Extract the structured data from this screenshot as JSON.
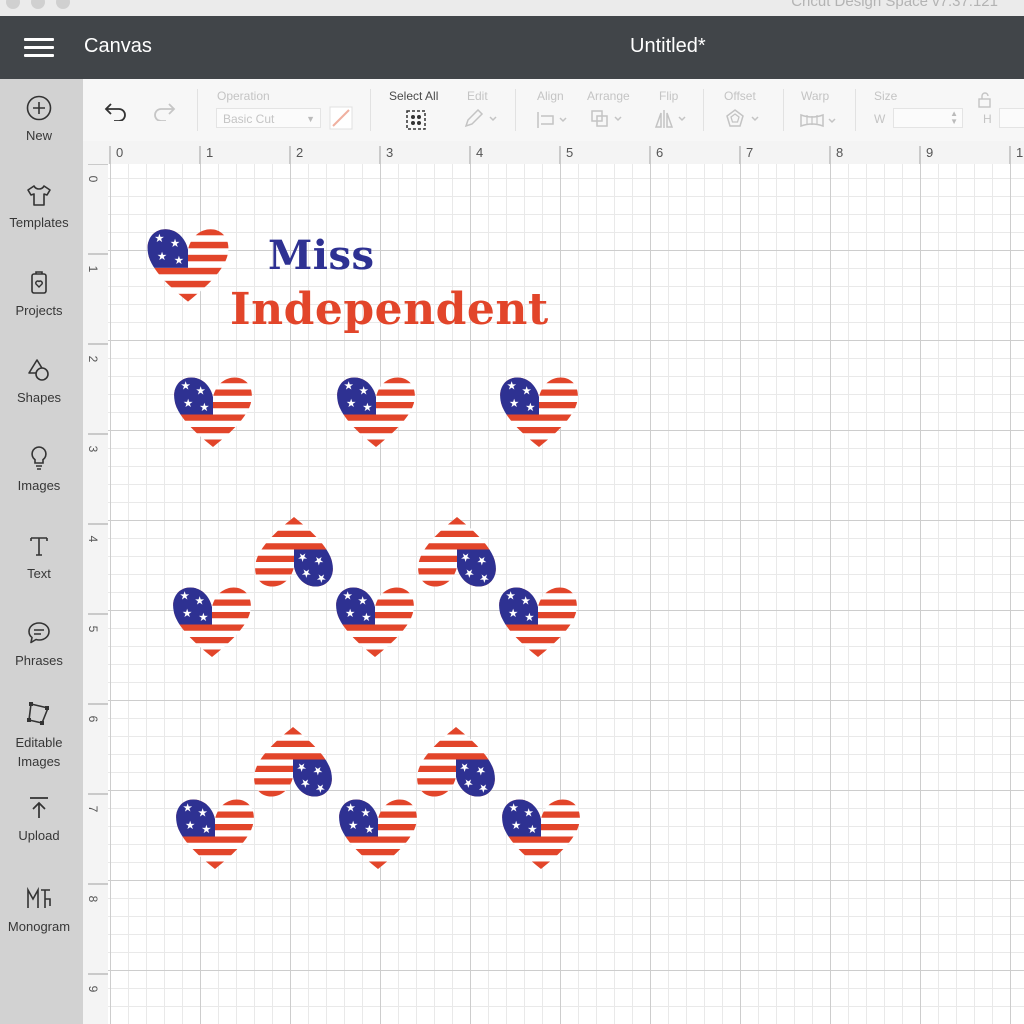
{
  "window": {
    "title": "Cricut Design Space  v7.37.121"
  },
  "header": {
    "brand": "Canvas",
    "document_title": "Untitled*"
  },
  "sidebar": {
    "items": [
      {
        "label": "New",
        "icon": "plus-circle-icon"
      },
      {
        "label": "Templates",
        "icon": "tshirt-icon"
      },
      {
        "label": "Projects",
        "icon": "projects-icon"
      },
      {
        "label": "Shapes",
        "icon": "shapes-icon"
      },
      {
        "label": "Images",
        "icon": "lightbulb-icon"
      },
      {
        "label": "Text",
        "icon": "text-icon"
      },
      {
        "label": "Phrases",
        "icon": "speech-bubble-icon"
      },
      {
        "label": "Editable Images",
        "icon": "editable-images-icon"
      },
      {
        "label": "Upload",
        "icon": "upload-icon"
      },
      {
        "label": "Monogram",
        "icon": "monogram-icon"
      }
    ]
  },
  "toolbar": {
    "operation_label": "Operation",
    "operation_value": "Basic Cut",
    "select_all_label": "Select All",
    "edit_label": "Edit",
    "align_label": "Align",
    "arrange_label": "Arrange",
    "flip_label": "Flip",
    "offset_label": "Offset",
    "warp_label": "Warp",
    "size_label": "Size",
    "width_label": "W",
    "height_label": "H"
  },
  "rulers": {
    "horizontal": [
      "0",
      "1",
      "2",
      "3",
      "4",
      "5",
      "6",
      "7",
      "8",
      "9",
      "1"
    ],
    "vertical": [
      "0",
      "1",
      "2",
      "3",
      "4",
      "5",
      "6",
      "7",
      "8",
      "9"
    ]
  },
  "design": {
    "line1": "Miss",
    "line2": "Independent",
    "colors": {
      "red": "#e2452a",
      "blue": "#2e3192",
      "white": "#ffffff"
    }
  }
}
